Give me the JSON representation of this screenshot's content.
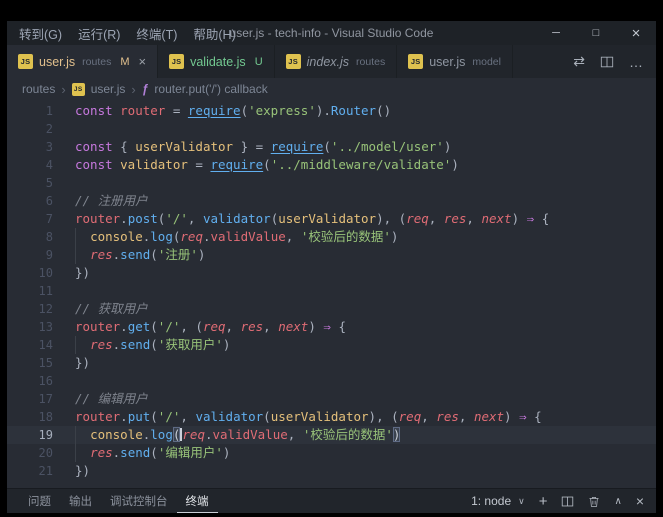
{
  "title_bar": {
    "menus": [
      "转到(G)",
      "运行(R)",
      "终端(T)",
      "帮助(H)"
    ],
    "title": "user.js - tech-info - Visual Studio Code"
  },
  "icons": {
    "js_label": "JS",
    "close": "×",
    "minimize": "─",
    "maximize": "□",
    "more": "…",
    "open_changes": "⇄",
    "chevron_down": "∨",
    "chevron_up": "∧",
    "breadcrumb_separator": "›",
    "plus": "+",
    "symbol_method": "ƒ"
  },
  "tabs": [
    {
      "label": "user.js",
      "detail": "routes",
      "badge": "M",
      "active": true
    },
    {
      "label": "validate.js",
      "detail": "",
      "badge": "U",
      "active": false
    },
    {
      "label": "index.js",
      "detail": "routes",
      "badge": "",
      "active": false
    },
    {
      "label": "user.js",
      "detail": "model",
      "badge": "",
      "active": false
    }
  ],
  "breadcrumb": {
    "folder": "routes",
    "file": "user.js",
    "symbol": "router.put('/') callback"
  },
  "editor": {
    "active_line": 19,
    "lines": [
      {
        "n": 1,
        "t": [
          [
            "kw",
            "const "
          ],
          [
            "var",
            "router"
          ],
          [
            "pl",
            " = "
          ],
          [
            "req",
            "require"
          ],
          [
            "pl",
            "("
          ],
          [
            "str",
            "'express'"
          ],
          [
            "pl",
            ")."
          ],
          [
            "fn",
            "Router"
          ],
          [
            "pl",
            "()"
          ]
        ]
      },
      {
        "n": 2,
        "t": []
      },
      {
        "n": 3,
        "t": [
          [
            "kw",
            "const "
          ],
          [
            "pl",
            "{ "
          ],
          [
            "id",
            "userValidator"
          ],
          [
            "pl",
            " } = "
          ],
          [
            "req",
            "require"
          ],
          [
            "pl",
            "("
          ],
          [
            "str",
            "'../model/user'"
          ],
          [
            "pl",
            ")"
          ]
        ]
      },
      {
        "n": 4,
        "t": [
          [
            "kw",
            "const "
          ],
          [
            "id",
            "validator"
          ],
          [
            "pl",
            " = "
          ],
          [
            "req",
            "require"
          ],
          [
            "pl",
            "("
          ],
          [
            "str",
            "'../middleware/validate'"
          ],
          [
            "pl",
            ")"
          ]
        ]
      },
      {
        "n": 5,
        "t": []
      },
      {
        "n": 6,
        "t": [
          [
            "cmt",
            "// 注册用户"
          ]
        ]
      },
      {
        "n": 7,
        "t": [
          [
            "var",
            "router"
          ],
          [
            "pl",
            "."
          ],
          [
            "fn",
            "post"
          ],
          [
            "pl",
            "("
          ],
          [
            "str",
            "'/'"
          ],
          [
            "pl",
            ", "
          ],
          [
            "fn",
            "validator"
          ],
          [
            "pl",
            "("
          ],
          [
            "id",
            "userValidator"
          ],
          [
            "pl",
            "), ("
          ],
          [
            "pm",
            "req"
          ],
          [
            "pl",
            ", "
          ],
          [
            "pm",
            "res"
          ],
          [
            "pl",
            ", "
          ],
          [
            "pm",
            "next"
          ],
          [
            "pl",
            ") "
          ],
          [
            "ar",
            "⇒"
          ],
          [
            "pl",
            " {"
          ]
        ]
      },
      {
        "n": 8,
        "g": 1,
        "t": [
          [
            "pl",
            "  "
          ],
          [
            "id",
            "console"
          ],
          [
            "pl",
            "."
          ],
          [
            "fn",
            "log"
          ],
          [
            "pl",
            "("
          ],
          [
            "pm",
            "req"
          ],
          [
            "pl",
            "."
          ],
          [
            "pr",
            "validValue"
          ],
          [
            "pl",
            ", "
          ],
          [
            "str",
            "'校验后的数据'"
          ],
          [
            "pl",
            ")"
          ]
        ]
      },
      {
        "n": 9,
        "g": 1,
        "t": [
          [
            "pl",
            "  "
          ],
          [
            "pm",
            "res"
          ],
          [
            "pl",
            "."
          ],
          [
            "fn",
            "send"
          ],
          [
            "pl",
            "("
          ],
          [
            "str",
            "'注册'"
          ],
          [
            "pl",
            ")"
          ]
        ]
      },
      {
        "n": 10,
        "t": [
          [
            "pl",
            "})"
          ]
        ]
      },
      {
        "n": 11,
        "t": []
      },
      {
        "n": 12,
        "t": [
          [
            "cmt",
            "// 获取用户"
          ]
        ]
      },
      {
        "n": 13,
        "t": [
          [
            "var",
            "router"
          ],
          [
            "pl",
            "."
          ],
          [
            "fn",
            "get"
          ],
          [
            "pl",
            "("
          ],
          [
            "str",
            "'/'"
          ],
          [
            "pl",
            ", ("
          ],
          [
            "pm",
            "req"
          ],
          [
            "pl",
            ", "
          ],
          [
            "pm",
            "res"
          ],
          [
            "pl",
            ", "
          ],
          [
            "pm",
            "next"
          ],
          [
            "pl",
            ") "
          ],
          [
            "ar",
            "⇒"
          ],
          [
            "pl",
            " {"
          ]
        ]
      },
      {
        "n": 14,
        "g": 1,
        "t": [
          [
            "pl",
            "  "
          ],
          [
            "pm",
            "res"
          ],
          [
            "pl",
            "."
          ],
          [
            "fn",
            "send"
          ],
          [
            "pl",
            "("
          ],
          [
            "str",
            "'获取用户'"
          ],
          [
            "pl",
            ")"
          ]
        ]
      },
      {
        "n": 15,
        "t": [
          [
            "pl",
            "})"
          ]
        ]
      },
      {
        "n": 16,
        "t": []
      },
      {
        "n": 17,
        "t": [
          [
            "cmt",
            "// 编辑用户"
          ]
        ]
      },
      {
        "n": 18,
        "t": [
          [
            "var",
            "router"
          ],
          [
            "pl",
            "."
          ],
          [
            "fn",
            "put"
          ],
          [
            "pl",
            "("
          ],
          [
            "str",
            "'/'"
          ],
          [
            "pl",
            ", "
          ],
          [
            "fn",
            "validator"
          ],
          [
            "pl",
            "("
          ],
          [
            "id",
            "userValidator"
          ],
          [
            "pl",
            "), ("
          ],
          [
            "pm",
            "req"
          ],
          [
            "pl",
            ", "
          ],
          [
            "pm",
            "res"
          ],
          [
            "pl",
            ", "
          ],
          [
            "pm",
            "next"
          ],
          [
            "pl",
            ") "
          ],
          [
            "ar",
            "⇒"
          ],
          [
            "pl",
            " {"
          ]
        ]
      },
      {
        "n": 19,
        "g": 1,
        "t": [
          [
            "pl",
            "  "
          ],
          [
            "id",
            "console"
          ],
          [
            "pl",
            "."
          ],
          [
            "fn",
            "log"
          ],
          [
            "mt",
            "("
          ],
          [
            "cr",
            ""
          ],
          [
            "pm",
            "req"
          ],
          [
            "pl",
            "."
          ],
          [
            "pr",
            "validValue"
          ],
          [
            "pl",
            ", "
          ],
          [
            "str",
            "'校验后的数据'"
          ],
          [
            "mt",
            ")"
          ]
        ]
      },
      {
        "n": 20,
        "g": 1,
        "t": [
          [
            "pl",
            "  "
          ],
          [
            "pm",
            "res"
          ],
          [
            "pl",
            "."
          ],
          [
            "fn",
            "send"
          ],
          [
            "pl",
            "("
          ],
          [
            "str",
            "'编辑用户'"
          ],
          [
            "pl",
            ")"
          ]
        ]
      },
      {
        "n": 21,
        "t": [
          [
            "pl",
            "})"
          ]
        ]
      }
    ]
  },
  "panel": {
    "tabs": [
      {
        "label": "问题"
      },
      {
        "label": "输出"
      },
      {
        "label": "调试控制台"
      },
      {
        "label": "终端",
        "active": true
      }
    ],
    "terminal_select": "1: node"
  },
  "colors": {
    "background": "#282c34",
    "chrome": "#21252b",
    "accent": "#61afef",
    "git_modified": "#e2c08d",
    "git_untracked": "#73c991",
    "keyword": "#c678dd",
    "string": "#98c379",
    "function": "#61afef",
    "variable": "#e06c75",
    "constant": "#e5c07b",
    "comment": "#7f848e"
  }
}
